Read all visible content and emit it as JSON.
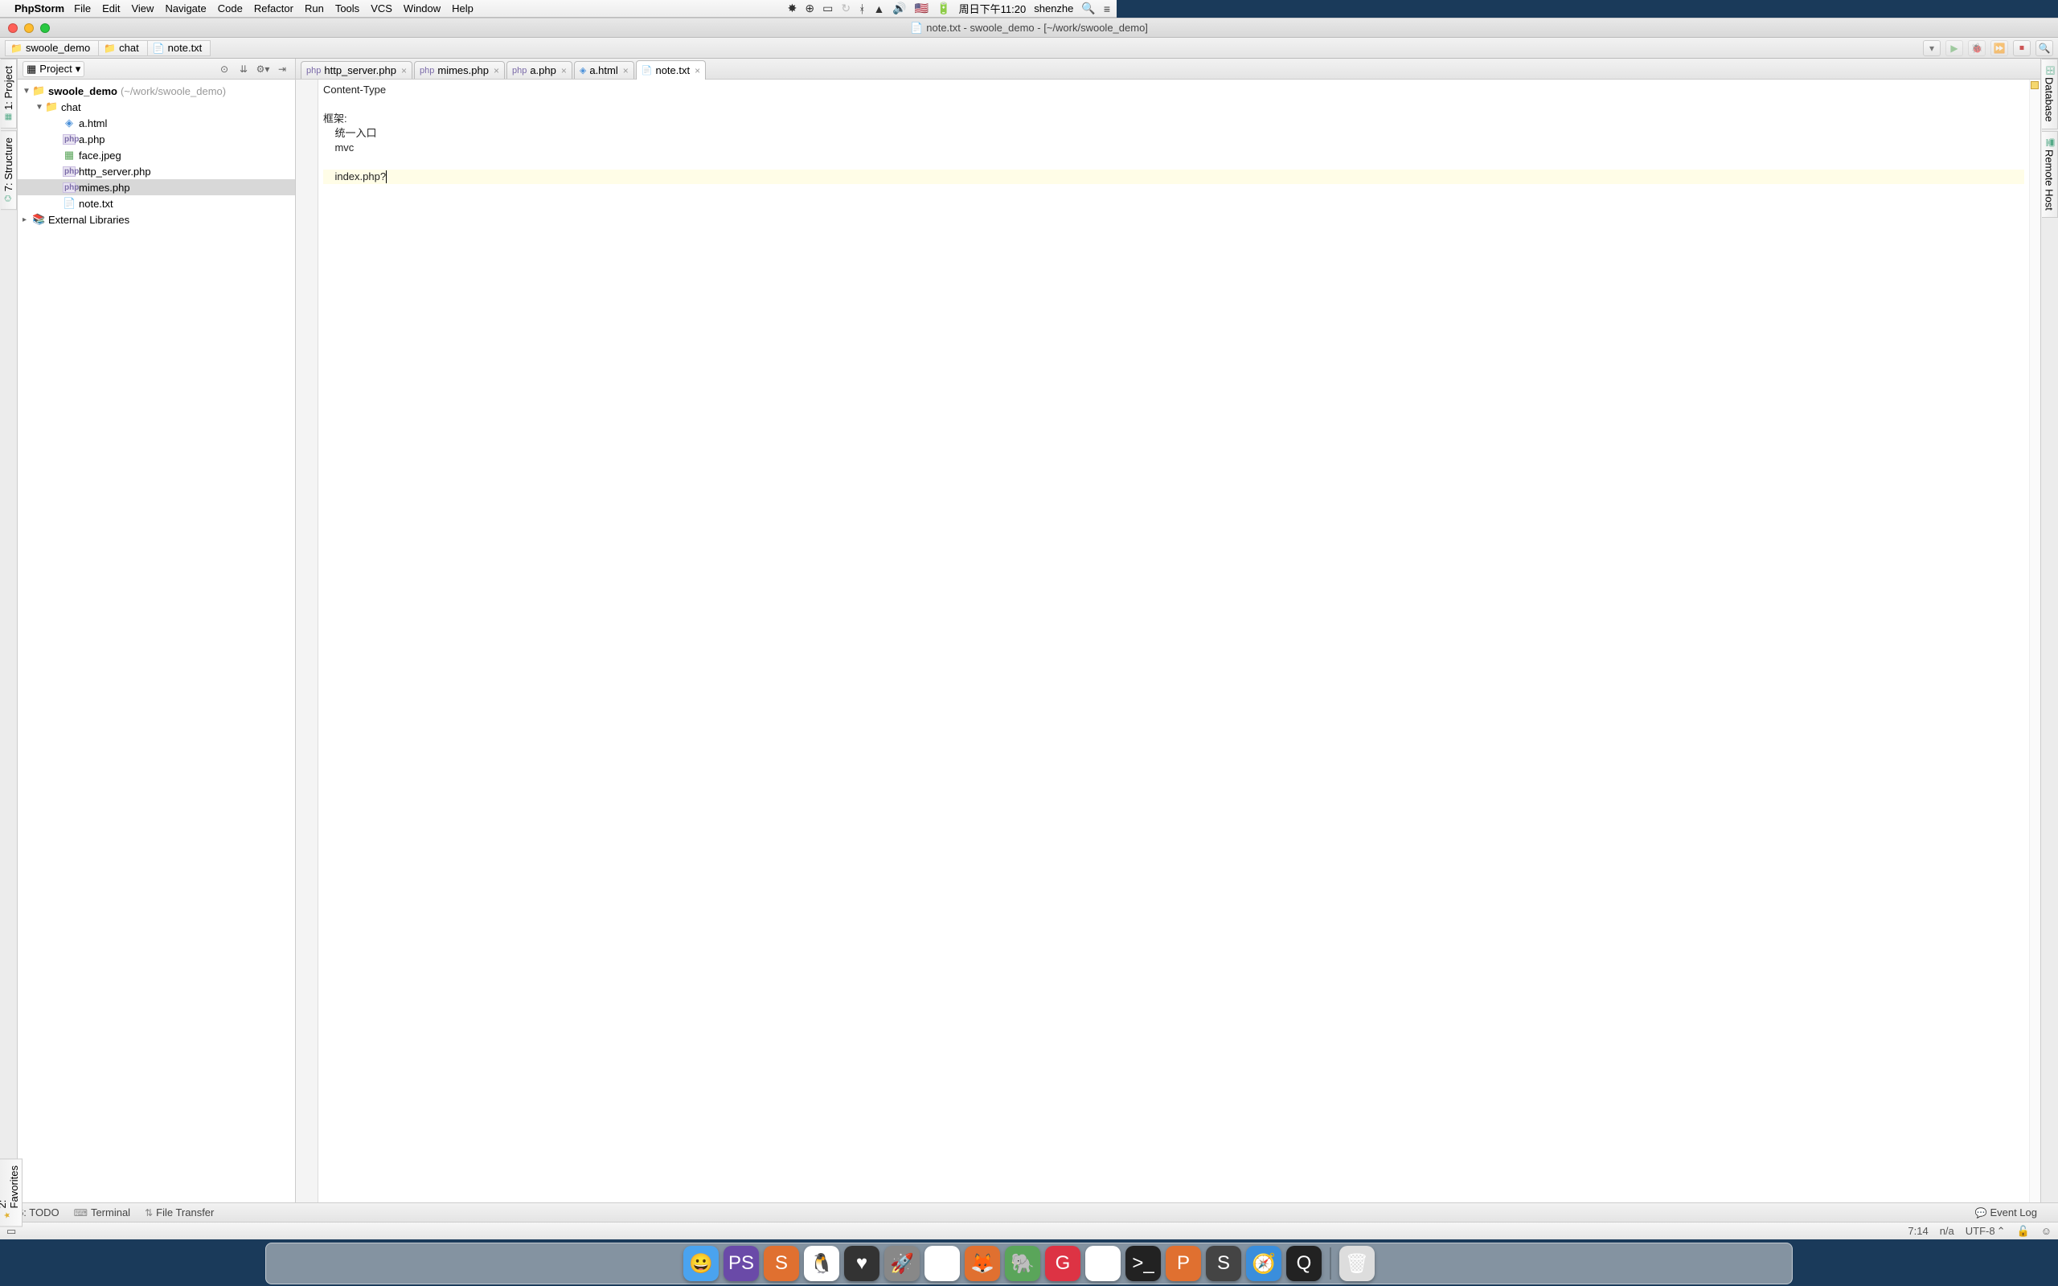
{
  "menubar": {
    "app": "PhpStorm",
    "items": [
      "File",
      "Edit",
      "View",
      "Navigate",
      "Code",
      "Refactor",
      "Run",
      "Tools",
      "VCS",
      "Window",
      "Help"
    ],
    "clock": "周日下午11:20",
    "user": "shenzhe"
  },
  "window": {
    "title": "note.txt - swoole_demo - [~/work/swoole_demo]"
  },
  "breadcrumbs": [
    {
      "label": "swoole_demo",
      "type": "folder"
    },
    {
      "label": "chat",
      "type": "folder"
    },
    {
      "label": "note.txt",
      "type": "file"
    }
  ],
  "left_tools": {
    "project": "1: Project",
    "structure": "7: Structure",
    "favorites": "2: Favorites"
  },
  "right_tools": {
    "database": "Database",
    "remote": "Remote Host"
  },
  "project_panel": {
    "title": "Project",
    "root": {
      "name": "swoole_demo",
      "path": "(~/work/swoole_demo)"
    },
    "chat": "chat",
    "files": [
      {
        "name": "a.html",
        "type": "html"
      },
      {
        "name": "a.php",
        "type": "php"
      },
      {
        "name": "face.jpeg",
        "type": "img"
      },
      {
        "name": "http_server.php",
        "type": "php"
      },
      {
        "name": "mimes.php",
        "type": "php",
        "selected": true
      },
      {
        "name": "note.txt",
        "type": "txt"
      }
    ],
    "external": "External Libraries"
  },
  "tabs": [
    {
      "label": "http_server.php",
      "type": "php"
    },
    {
      "label": "mimes.php",
      "type": "php"
    },
    {
      "label": "a.php",
      "type": "php"
    },
    {
      "label": "a.html",
      "type": "html"
    },
    {
      "label": "note.txt",
      "type": "txt",
      "active": true
    }
  ],
  "editor": {
    "lines": [
      "Content-Type",
      "",
      "框架:",
      "    统一入口",
      "    mvc",
      "",
      "    index.php?"
    ],
    "cursor_line": 6
  },
  "bottom_tabs": {
    "todo": "6: TODO",
    "terminal": "Terminal",
    "file_transfer": "File Transfer",
    "event_log": "Event Log"
  },
  "status": {
    "pos": "7:14",
    "linesep": "n/a",
    "encoding": "UTF-8"
  },
  "dock": [
    {
      "name": "finder",
      "bg": "#4aa3ef",
      "glyph": "😀"
    },
    {
      "name": "phpstorm",
      "bg": "#6a4aa8",
      "glyph": "PS"
    },
    {
      "name": "swoole",
      "bg": "#e07030",
      "glyph": "S"
    },
    {
      "name": "qq",
      "bg": "#fff",
      "glyph": "🐧"
    },
    {
      "name": "github",
      "bg": "#333",
      "glyph": "♥"
    },
    {
      "name": "launchpad",
      "bg": "#888",
      "glyph": "🚀"
    },
    {
      "name": "chrome",
      "bg": "#fff",
      "glyph": "◎"
    },
    {
      "name": "firefox",
      "bg": "#e07030",
      "glyph": "🦊"
    },
    {
      "name": "evernote",
      "bg": "#5aa55a",
      "glyph": "🐘"
    },
    {
      "name": "app1",
      "bg": "#d34",
      "glyph": "G"
    },
    {
      "name": "app2",
      "bg": "#fff",
      "glyph": "✎"
    },
    {
      "name": "iterm",
      "bg": "#222",
      "glyph": ">_"
    },
    {
      "name": "app3",
      "bg": "#e07030",
      "glyph": "P"
    },
    {
      "name": "sublime",
      "bg": "#444",
      "glyph": "S"
    },
    {
      "name": "safari",
      "bg": "#3a8edc",
      "glyph": "🧭"
    },
    {
      "name": "quicktime",
      "bg": "#222",
      "glyph": "Q"
    },
    {
      "name": "trash",
      "bg": "#ddd",
      "glyph": "🗑"
    }
  ]
}
